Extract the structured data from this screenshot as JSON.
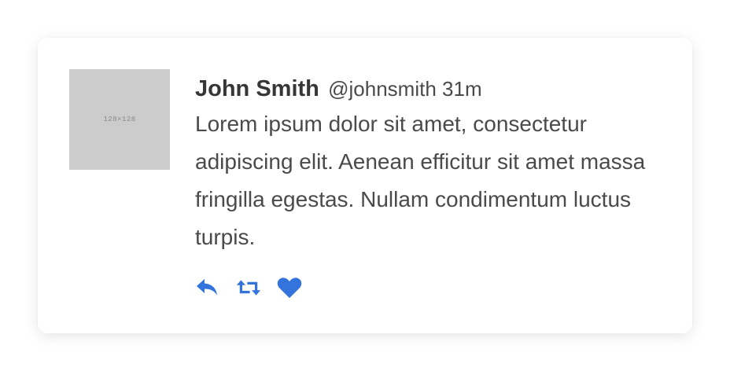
{
  "card": {
    "avatar": {
      "placeholder_text": "128×128"
    },
    "header": {
      "name": "John Smith",
      "handle": "@johnsmith",
      "time": "31m"
    },
    "body": "Lorem ipsum dolor sit amet, consectetur adipiscing elit. Aenean efficitur sit amet massa fringilla egestas. Nullam condimentum luctus turpis.",
    "actions": [
      {
        "icon": "reply-icon"
      },
      {
        "icon": "retweet-icon"
      },
      {
        "icon": "heart-icon"
      }
    ],
    "colors": {
      "accent": "#3273dc",
      "avatar_bg": "#cccccc",
      "text": "#4a4a4a",
      "name": "#363636"
    }
  }
}
